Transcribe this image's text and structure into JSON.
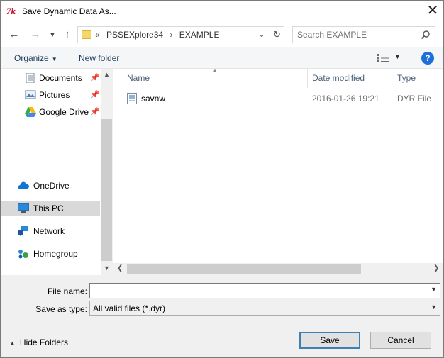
{
  "window": {
    "title": "Save Dynamic Data As...",
    "app_icon_glyph": "7k",
    "close_glyph": "✕"
  },
  "address": {
    "crumbs": [
      "«",
      "PSSEXplore34",
      "›",
      "EXAMPLE"
    ],
    "search_placeholder": "Search EXAMPLE"
  },
  "toolbar": {
    "organize": "Organize",
    "new_folder": "New folder",
    "help": "?"
  },
  "nav": {
    "items": [
      {
        "label": "Documents",
        "icon": "documents-icon",
        "pinned": true
      },
      {
        "label": "Pictures",
        "icon": "pictures-icon",
        "pinned": true
      },
      {
        "label": "Google Drive",
        "icon": "google-drive-icon",
        "pinned": true
      },
      {
        "label": "OneDrive",
        "icon": "onedrive-icon",
        "pinned": false
      },
      {
        "label": "This PC",
        "icon": "this-pc-icon",
        "pinned": false,
        "selected": true
      },
      {
        "label": "Network",
        "icon": "network-icon",
        "pinned": false
      },
      {
        "label": "Homegroup",
        "icon": "homegroup-icon",
        "pinned": false
      }
    ]
  },
  "columns": {
    "name": "Name",
    "date": "Date modified",
    "type": "Type"
  },
  "files": [
    {
      "name": "savnw",
      "date": "2016-01-26 19:21",
      "type": "DYR File"
    }
  ],
  "form": {
    "file_name_label": "File name:",
    "file_name_value": "",
    "save_type_label": "Save as type:",
    "save_type_value": "All valid files (*.dyr)"
  },
  "footer": {
    "hide_folders": "Hide Folders",
    "save": "Save",
    "cancel": "Cancel"
  },
  "colors": {
    "accent": "#1e6fd9",
    "selected_bg": "#d9d9d9",
    "link_text": "#1e3a5f"
  }
}
